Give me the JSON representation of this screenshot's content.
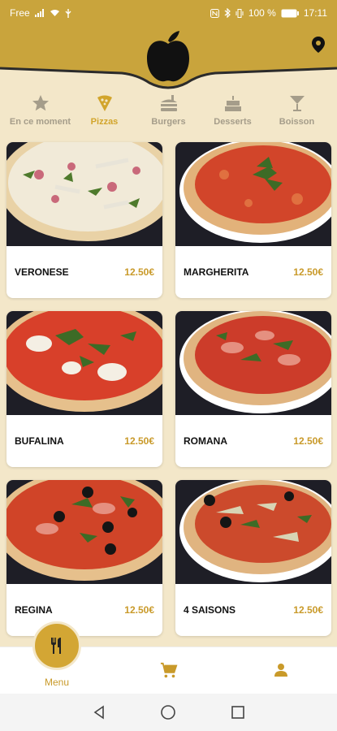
{
  "status_bar": {
    "carrier": "Free",
    "battery": "100 %",
    "time": "17:11"
  },
  "colors": {
    "brand_gold": "#c9a43c",
    "accent": "#d2a52c",
    "price": "#c99a2a",
    "background": "#f3e7c9"
  },
  "categories": [
    {
      "label": "En ce moment",
      "icon": "star-icon"
    },
    {
      "label": "Pizzas",
      "icon": "pizza-slice-icon",
      "active": true
    },
    {
      "label": "Burgers",
      "icon": "burger-icon"
    },
    {
      "label": "Desserts",
      "icon": "cake-icon"
    },
    {
      "label": "Boisson",
      "icon": "cocktail-icon"
    }
  ],
  "products": [
    {
      "name": "VERONESE",
      "price": "12.50€"
    },
    {
      "name": "MARGHERITA",
      "price": "12.50€"
    },
    {
      "name": "BUFALINA",
      "price": "12.50€"
    },
    {
      "name": "ROMANA",
      "price": "12.50€"
    },
    {
      "name": "REGINA",
      "price": "12.50€"
    },
    {
      "name": "4 SAISONS",
      "price": "12.50€"
    }
  ],
  "bottom_nav": {
    "menu_label": "Menu"
  }
}
